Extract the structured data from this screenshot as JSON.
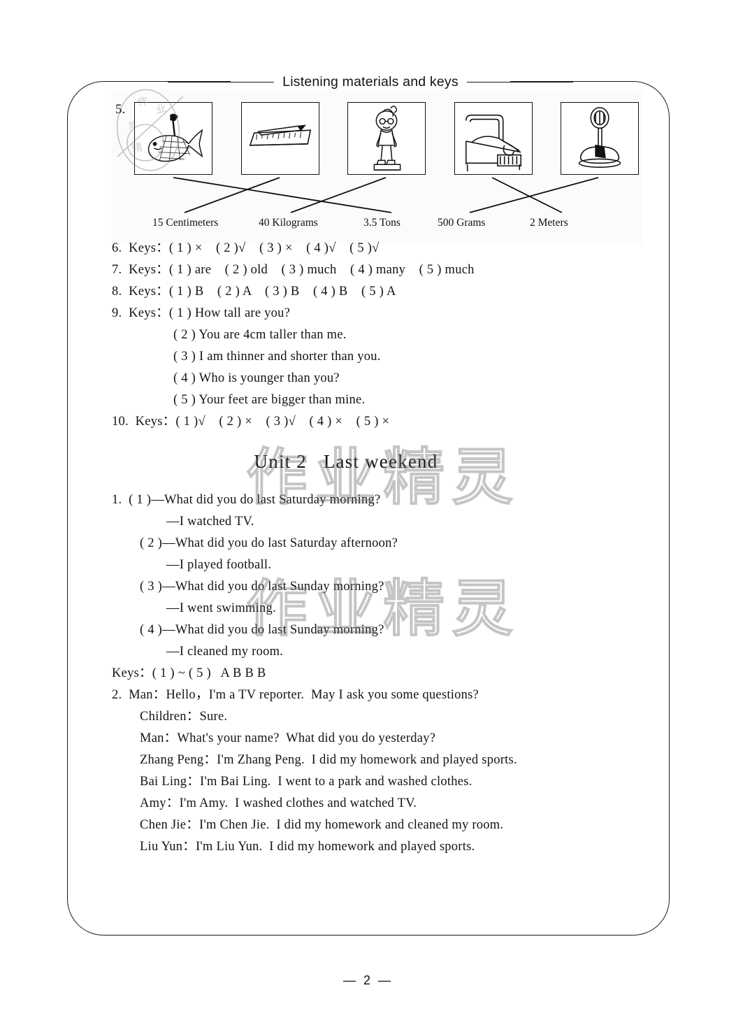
{
  "header": {
    "running_title": "Listening materials and keys"
  },
  "watermark": {
    "text": "作业精灵",
    "seal_text": "作业精灵"
  },
  "exercise5": {
    "number": "5.",
    "pictures": [
      {
        "name": "whale-in-net",
        "matches": "3.5 Tons"
      },
      {
        "name": "ruler-and-pencil",
        "matches": "15 Centimeters"
      },
      {
        "name": "boy-on-scale",
        "matches": "40 Kilograms"
      },
      {
        "name": "bed",
        "matches": "2 Meters"
      },
      {
        "name": "weighing-scale",
        "matches": "500 Grams"
      }
    ],
    "labels": [
      "15 Centimeters",
      "40 Kilograms",
      "3.5 Tons",
      "500 Grams",
      "2 Meters"
    ]
  },
  "keys": {
    "item6": "6.  Keys：( 1 ) ×    ( 2 )√    ( 3 ) ×    ( 4 )√    ( 5 )√",
    "item7": "7.  Keys：( 1 ) are    ( 2 ) old    ( 3 ) much    ( 4 ) many    ( 5 ) much",
    "item8": "8.  Keys：( 1 ) B    ( 2 ) A    ( 3 ) B    ( 4 ) B    ( 5 ) A",
    "item9_head": "9.  Keys：( 1 ) How tall are you?",
    "item9_2": "( 2 ) You are 4cm taller than me.",
    "item9_3": "( 3 ) I am thinner and shorter than you.",
    "item9_4": "( 4 ) Who is younger than you?",
    "item9_5": "( 5 ) Your feet are bigger than mine.",
    "item10": "10.  Keys：( 1 )√    ( 2 ) ×    ( 3 )√    ( 4 ) ×    ( 5 ) ×"
  },
  "unit": {
    "title": "Unit 2   Last weekend"
  },
  "unit2_ex1": {
    "q1": "1.  ( 1 )—What did you do last Saturday morning?",
    "a1": "—I watched TV.",
    "q2": "( 2 )—What did you do last Saturday afternoon?",
    "a2": "—I played football.",
    "q3": "( 3 )—What did you do last Sunday morning?",
    "a3": "—I went swimming.",
    "q4": "( 4 )—What did you do last Sunday morning?",
    "a4": "—I cleaned my room.",
    "keys": "Keys：( 1 ) ~ ( 5 )   A B B B"
  },
  "unit2_ex2": {
    "l1": "2.  Man：Hello，I'm a TV reporter.  May I ask you some questions?",
    "l2": "Children：Sure.",
    "l3": "Man：What's your name?  What did you do yesterday?",
    "l4": "Zhang Peng：I'm Zhang Peng.  I did my homework and played sports.",
    "l5": "Bai Ling：I'm Bai Ling.  I went to a park and washed clothes.",
    "l6": "Amy：I'm Amy.  I washed clothes and watched TV.",
    "l7": "Chen Jie：I'm Chen Jie.  I did my homework and cleaned my room.",
    "l8": "Liu Yun：I'm Liu Yun.  I did my homework and played sports."
  },
  "footer": {
    "page_number": "— 2 —"
  }
}
